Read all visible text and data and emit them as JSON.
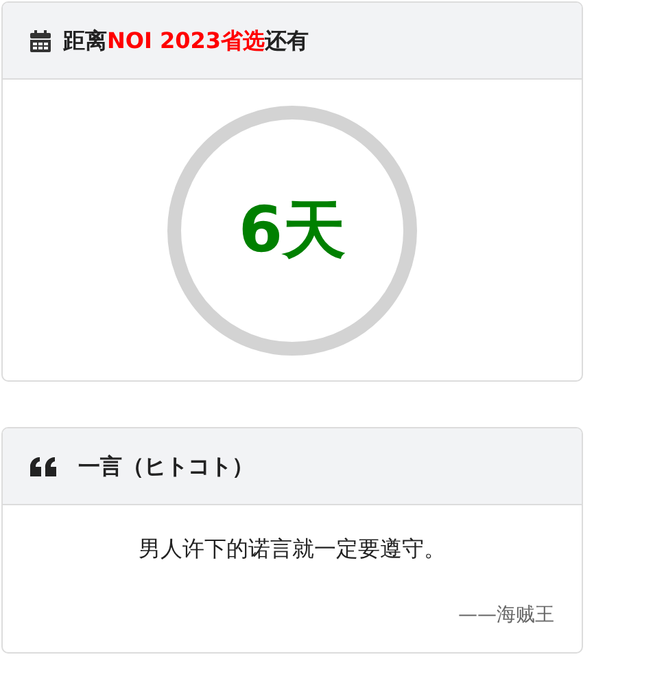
{
  "countdown_card": {
    "title_parts": [
      {
        "text": "距离",
        "highlight": false
      },
      {
        "text": "NOI 2023省选",
        "highlight": true
      },
      {
        "text": "还有",
        "highlight": false
      }
    ],
    "days": "6天"
  },
  "quote_card": {
    "title": "一言（ヒトコト）",
    "quote": "男人许下的诺言就一定要遵守。",
    "source": "——海贼王"
  }
}
